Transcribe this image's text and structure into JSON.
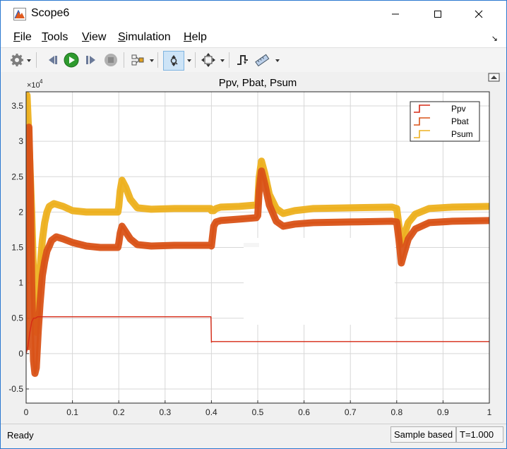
{
  "window": {
    "title": "Scope6"
  },
  "menu": {
    "items": [
      "File",
      "Tools",
      "View",
      "Simulation",
      "Help"
    ],
    "underline": [
      "F",
      "T",
      "V",
      "S",
      "H"
    ]
  },
  "toolbar": {
    "icons": [
      "gear-icon",
      "step-back-icon",
      "run-icon",
      "step-forward-icon",
      "stop-icon",
      "signal-select-icon",
      "zoom-icon",
      "fit-to-view-icon",
      "triggers-icon",
      "measurements-icon"
    ]
  },
  "chart_data": {
    "type": "line",
    "title": "Ppv, Pbat, Psum",
    "multiplier": "×10",
    "multiplier_exp": "4",
    "xlim": [
      0,
      1
    ],
    "ylim": [
      -0.7,
      3.7
    ],
    "xticks": [
      "0",
      "0.1",
      "0.2",
      "0.3",
      "0.4",
      "0.5",
      "0.6",
      "0.7",
      "0.8",
      "0.9",
      "1"
    ],
    "yticks": [
      "-0.5",
      "0",
      "0.5",
      "1",
      "1.5",
      "2",
      "2.5",
      "3",
      "3.5"
    ],
    "grid": true,
    "legend_position": "top-right",
    "series": [
      {
        "name": "Ppv",
        "color": "#d62a16",
        "points": [
          [
            0,
            0
          ],
          [
            0.004,
            0.1
          ],
          [
            0.008,
            0.3
          ],
          [
            0.012,
            0.45
          ],
          [
            0.016,
            0.5
          ],
          [
            0.02,
            0.5
          ],
          [
            0.025,
            0.52
          ],
          [
            0.399,
            0.52
          ],
          [
            0.4,
            0.16
          ],
          [
            0.401,
            0.17
          ],
          [
            1,
            0.17
          ]
        ]
      },
      {
        "name": "Pbat",
        "color": "#d95318",
        "points": [
          [
            0,
            0.05
          ],
          [
            0.003,
            1.5
          ],
          [
            0.006,
            3.2
          ],
          [
            0.009,
            2.4
          ],
          [
            0.012,
            1.0
          ],
          [
            0.016,
            -0.1
          ],
          [
            0.019,
            -0.28
          ],
          [
            0.022,
            -0.2
          ],
          [
            0.026,
            0.3
          ],
          [
            0.03,
            0.7
          ],
          [
            0.035,
            1.1
          ],
          [
            0.04,
            1.3
          ],
          [
            0.045,
            1.45
          ],
          [
            0.05,
            1.52
          ],
          [
            0.055,
            1.6
          ],
          [
            0.065,
            1.65
          ],
          [
            0.08,
            1.62
          ],
          [
            0.1,
            1.57
          ],
          [
            0.13,
            1.52
          ],
          [
            0.16,
            1.5
          ],
          [
            0.198,
            1.5
          ],
          [
            0.2,
            1.56
          ],
          [
            0.203,
            1.7
          ],
          [
            0.207,
            1.8
          ],
          [
            0.215,
            1.72
          ],
          [
            0.225,
            1.62
          ],
          [
            0.24,
            1.54
          ],
          [
            0.27,
            1.52
          ],
          [
            0.32,
            1.53
          ],
          [
            0.398,
            1.53
          ],
          [
            0.4,
            1.52
          ],
          [
            0.405,
            1.8
          ],
          [
            0.41,
            1.86
          ],
          [
            0.42,
            1.88
          ],
          [
            0.46,
            1.9
          ],
          [
            0.497,
            1.92
          ],
          [
            0.5,
            1.95
          ],
          [
            0.503,
            2.3
          ],
          [
            0.508,
            2.58
          ],
          [
            0.515,
            2.4
          ],
          [
            0.525,
            2.1
          ],
          [
            0.54,
            1.87
          ],
          [
            0.555,
            1.8
          ],
          [
            0.58,
            1.83
          ],
          [
            0.62,
            1.85
          ],
          [
            0.7,
            1.86
          ],
          [
            0.79,
            1.87
          ],
          [
            0.8,
            1.86
          ],
          [
            0.805,
            1.6
          ],
          [
            0.81,
            1.28
          ],
          [
            0.815,
            1.4
          ],
          [
            0.825,
            1.62
          ],
          [
            0.84,
            1.76
          ],
          [
            0.87,
            1.85
          ],
          [
            0.92,
            1.87
          ],
          [
            1,
            1.88
          ]
        ]
      },
      {
        "name": "Psum",
        "color": "#edb120",
        "points": [
          [
            0,
            3.5
          ],
          [
            0.002,
            3.65
          ],
          [
            0.005,
            3.2
          ],
          [
            0.008,
            2.7
          ],
          [
            0.012,
            2.0
          ],
          [
            0.016,
            1.1
          ],
          [
            0.019,
            0.4
          ],
          [
            0.022,
            0.3
          ],
          [
            0.026,
            0.8
          ],
          [
            0.03,
            1.2
          ],
          [
            0.035,
            1.6
          ],
          [
            0.04,
            1.85
          ],
          [
            0.045,
            2.0
          ],
          [
            0.05,
            2.08
          ],
          [
            0.06,
            2.12
          ],
          [
            0.08,
            2.08
          ],
          [
            0.1,
            2.02
          ],
          [
            0.13,
            2.0
          ],
          [
            0.16,
            2.0
          ],
          [
            0.198,
            2.0
          ],
          [
            0.2,
            2.08
          ],
          [
            0.203,
            2.3
          ],
          [
            0.207,
            2.45
          ],
          [
            0.215,
            2.35
          ],
          [
            0.225,
            2.18
          ],
          [
            0.24,
            2.06
          ],
          [
            0.27,
            2.04
          ],
          [
            0.32,
            2.05
          ],
          [
            0.398,
            2.05
          ],
          [
            0.4,
            2.02
          ],
          [
            0.405,
            2.02
          ],
          [
            0.41,
            2.05
          ],
          [
            0.42,
            2.07
          ],
          [
            0.46,
            2.08
          ],
          [
            0.497,
            2.1
          ],
          [
            0.5,
            2.12
          ],
          [
            0.503,
            2.48
          ],
          [
            0.508,
            2.72
          ],
          [
            0.515,
            2.55
          ],
          [
            0.525,
            2.25
          ],
          [
            0.54,
            2.05
          ],
          [
            0.555,
            1.98
          ],
          [
            0.58,
            2.02
          ],
          [
            0.62,
            2.05
          ],
          [
            0.7,
            2.06
          ],
          [
            0.79,
            2.07
          ],
          [
            0.8,
            2.05
          ],
          [
            0.805,
            1.8
          ],
          [
            0.81,
            1.55
          ],
          [
            0.815,
            1.65
          ],
          [
            0.825,
            1.85
          ],
          [
            0.84,
            1.97
          ],
          [
            0.87,
            2.05
          ],
          [
            0.92,
            2.07
          ],
          [
            1,
            2.08
          ]
        ]
      }
    ]
  },
  "status": {
    "text": "Ready",
    "mode": "Sample based",
    "time": "T=1.000"
  }
}
